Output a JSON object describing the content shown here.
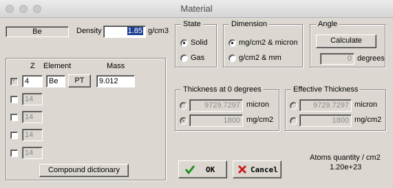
{
  "window": {
    "title": "Material"
  },
  "material": {
    "name": "Be",
    "density_label": "Density",
    "density_value": "1.85",
    "density_unit": "g/cm3"
  },
  "elements": {
    "headers": {
      "z": "Z",
      "element": "Element",
      "mass": "Mass"
    },
    "rows": [
      {
        "z": "4",
        "element": "Be",
        "pt_label": "PT",
        "mass": "9.012",
        "checked": true
      },
      {
        "z": "14"
      },
      {
        "z": "14"
      },
      {
        "z": "14"
      },
      {
        "z": "14"
      }
    ],
    "compound_button": "Compound dictionary"
  },
  "state": {
    "title": "State",
    "options": [
      "Solid",
      "Gas"
    ],
    "selected": "Solid"
  },
  "dimension": {
    "title": "Dimension",
    "options": [
      "mg/cm2 & micron",
      "g/cm2 & mm"
    ],
    "selected": "mg/cm2 & micron"
  },
  "angle": {
    "title": "Angle",
    "calculate_label": "Calculate",
    "value": "0",
    "unit": "degrees"
  },
  "thickness": {
    "title": "Thickness at 0 degrees",
    "micron_value": "9729.7297",
    "micron_unit": "micron",
    "mgcm2_value": "1800",
    "mgcm2_unit": "mg/cm2"
  },
  "effective": {
    "title": "Effective Thickness",
    "micron_value": "9729.7297",
    "micron_unit": "micron",
    "mgcm2_value": "1800",
    "mgcm2_unit": "mg/cm2"
  },
  "actions": {
    "ok": "OK",
    "cancel": "Cancel"
  },
  "atoms": {
    "label": "Atoms quantity / cm2",
    "value": "1.20e+23"
  },
  "colors": {
    "ok_check": "#1e8f1e",
    "cancel_x": "#c81e1e",
    "selection": "#1c3f93"
  }
}
